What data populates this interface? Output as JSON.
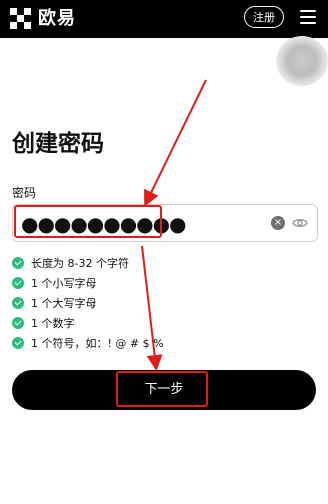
{
  "header": {
    "logo_text": "欧易",
    "register_label": "注册"
  },
  "page": {
    "title": "创建密码"
  },
  "password": {
    "label": "密码",
    "masked_value": "●●●●●●●●●●"
  },
  "requirements": [
    {
      "text": "长度为 8-32 个字符",
      "met": true
    },
    {
      "text": "1 个小写字母",
      "met": true
    },
    {
      "text": "1 个大写字母",
      "met": true
    },
    {
      "text": "1 个数字",
      "met": true
    },
    {
      "text": "1 个符号，如：! @ # $ %",
      "met": true
    }
  ],
  "next_button_label": "下一步",
  "colors": {
    "check_green": "#2ebc7b",
    "annotation_red": "#e21b1b",
    "primary_black": "#000000"
  }
}
